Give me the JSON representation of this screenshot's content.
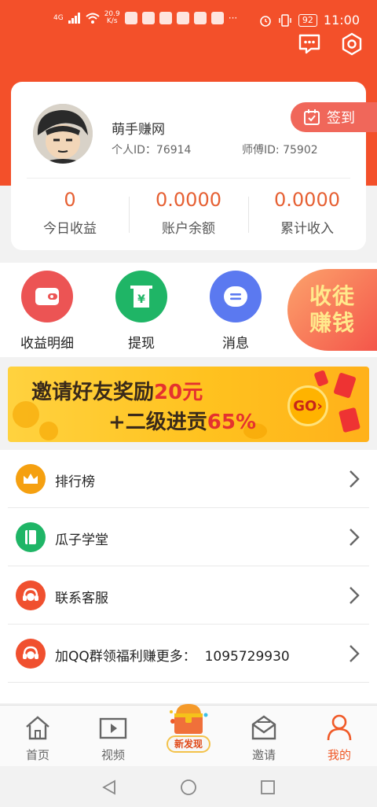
{
  "status_bar": {
    "network": "4G",
    "speed_value": "20.9",
    "speed_unit": "K/s",
    "battery": "92",
    "time": "11:00"
  },
  "header": {
    "message_icon": "message-icon",
    "settings_icon": "hexagon-settings-icon"
  },
  "profile": {
    "nickname": "萌手赚网",
    "user_id_label": "个人ID：",
    "user_id": "76914",
    "mentor_id_label": "师傅ID:",
    "mentor_id": "75902",
    "signin_label": "签到"
  },
  "stats": [
    {
      "value": "0",
      "label": "今日收益"
    },
    {
      "value": "0.0000",
      "label": "账户余额"
    },
    {
      "value": "0.0000",
      "label": "累计收入"
    }
  ],
  "actions": [
    {
      "label": "收益明细",
      "icon": "wallet-icon",
      "color": "#ec5454"
    },
    {
      "label": "提现",
      "icon": "atm-icon",
      "color": "#1fb566"
    },
    {
      "label": "消息",
      "icon": "message-icon",
      "color": "#5b79f0"
    }
  ],
  "recruit": {
    "line1": "收徒",
    "line2": "赚钱"
  },
  "banner": {
    "line1_text": "邀请好友奖励",
    "line1_highlight": "20元",
    "line2_text": "+二级进贡",
    "line2_highlight": "65%",
    "go_label": "GO"
  },
  "menu": [
    {
      "label": "排行榜",
      "icon": "crown-icon",
      "color": "#f5a010"
    },
    {
      "label": "瓜子学堂",
      "icon": "book-icon",
      "color": "#1fb566"
    },
    {
      "label": "联系客服",
      "icon": "headset-icon",
      "color": "#f0502f"
    },
    {
      "label": "加QQ群领福利赚更多：  1095729930",
      "icon": "headset-icon",
      "color": "#f0502f"
    }
  ],
  "tabs": [
    {
      "label": "首页",
      "icon": "home-icon"
    },
    {
      "label": "视频",
      "icon": "video-icon"
    },
    {
      "label": "新发现",
      "icon": "treasure-chest-icon"
    },
    {
      "label": "邀请",
      "icon": "envelope-icon"
    },
    {
      "label": "我的",
      "icon": "person-icon"
    }
  ],
  "colors": {
    "brand": "#f3502a",
    "accent": "#e66033",
    "active_tab": "#f05a28"
  }
}
